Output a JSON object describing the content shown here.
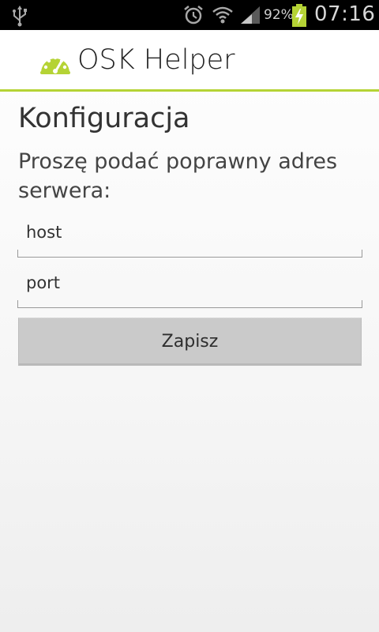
{
  "status_bar": {
    "battery_percent": "92%",
    "time": "07:16",
    "icons": [
      "usb-icon",
      "alarm-icon",
      "wifi-icon",
      "signal-icon",
      "battery-charging-icon"
    ]
  },
  "action_bar": {
    "title": "OSK Helper",
    "icon": "speedometer-icon",
    "accent_color": "#b5d335"
  },
  "content": {
    "heading": "Konfiguracja",
    "prompt": "Proszę podać poprawny adres serwera:"
  },
  "form": {
    "host_value": "host",
    "port_value": "port",
    "save_label": "Zapisz"
  }
}
